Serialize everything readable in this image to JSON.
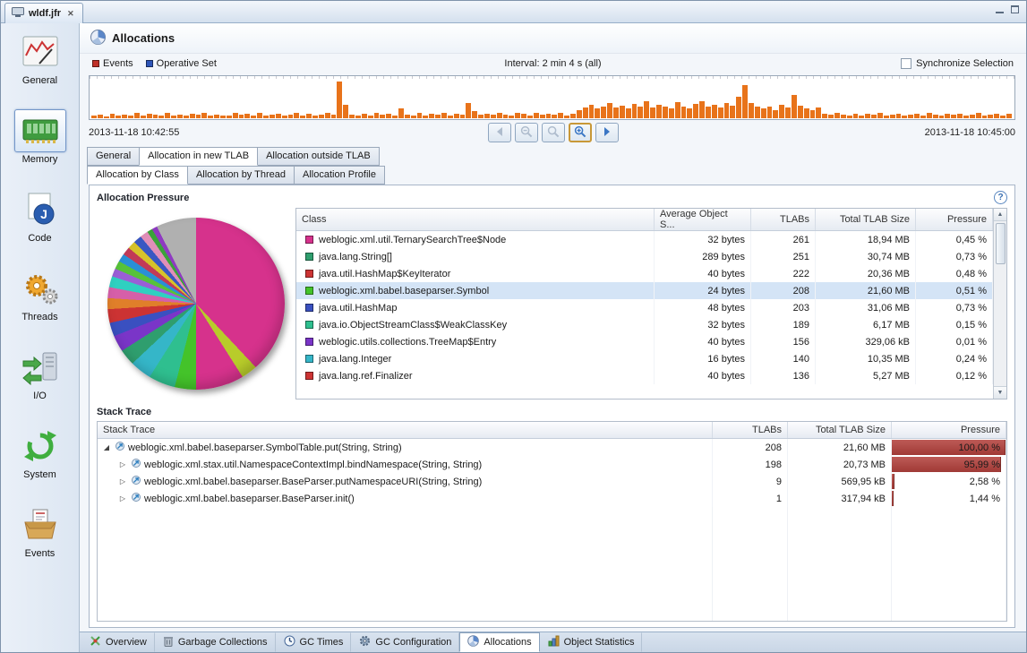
{
  "window": {
    "tab_title": "wldf.jfr"
  },
  "icons": {
    "close": "✕",
    "help": "?",
    "scroll_up": "▲",
    "scroll_down": "▼",
    "expanded": "◢",
    "collapsed": "▷"
  },
  "sidebar": {
    "items": [
      {
        "label": "General",
        "icon": "gauge-icon",
        "selected": false
      },
      {
        "label": "Memory",
        "icon": "ram-icon",
        "selected": true
      },
      {
        "label": "Code",
        "icon": "java-icon",
        "selected": false
      },
      {
        "label": "Threads",
        "icon": "gears-icon",
        "selected": false
      },
      {
        "label": "I/O",
        "icon": "io-arrows-icon",
        "selected": false
      },
      {
        "label": "System",
        "icon": "recycle-icon",
        "selected": false
      },
      {
        "label": "Events",
        "icon": "package-icon",
        "selected": false
      }
    ]
  },
  "header": {
    "title": "Allocations"
  },
  "timeline": {
    "legend": [
      {
        "label": "Events",
        "color": "#c03028"
      },
      {
        "label": "Operative Set",
        "color": "#2e55b8"
      }
    ],
    "interval": "Interval: 2 min 4 s (all)",
    "synchronize_label": "Synchronize Selection",
    "synchronized": false,
    "start": "2013-11-18 10:42:55",
    "end": "2013-11-18 10:45:00",
    "bar_color": "#e8731a",
    "bars": [
      6,
      9,
      5,
      12,
      7,
      10,
      8,
      14,
      6,
      11,
      9,
      7,
      13,
      8,
      10,
      6,
      12,
      9,
      15,
      7,
      10,
      8,
      6,
      13,
      9,
      11,
      7,
      14,
      8,
      10,
      12,
      6,
      9,
      15,
      8,
      11,
      7,
      10,
      13,
      9,
      95,
      35,
      10,
      8,
      12,
      7,
      14,
      9,
      11,
      6,
      25,
      10,
      8,
      13,
      7,
      11,
      9,
      15,
      8,
      12,
      10,
      40,
      18,
      10,
      12,
      9,
      14,
      10,
      8,
      13,
      11,
      7,
      15,
      9,
      12,
      10,
      14,
      8,
      11,
      22,
      28,
      35,
      25,
      30,
      40,
      28,
      33,
      26,
      38,
      30,
      45,
      28,
      35,
      30,
      26,
      42,
      30,
      26,
      38,
      45,
      30,
      35,
      28,
      40,
      32,
      55,
      85,
      40,
      30,
      25,
      30,
      22,
      35,
      28,
      60,
      32,
      25,
      20,
      28,
      12,
      9,
      14,
      10,
      8,
      12,
      7,
      11,
      9,
      13,
      8,
      10,
      12,
      7,
      9,
      11,
      8,
      13,
      10,
      7,
      12,
      9,
      11,
      8,
      10,
      13,
      7,
      9,
      12,
      8,
      11
    ]
  },
  "toolbar": {
    "buttons": [
      {
        "name": "back-button",
        "icon": "arrow-left-icon",
        "enabled": false,
        "focused": false
      },
      {
        "name": "zoom-out-button",
        "icon": "magnifier-minus-icon",
        "enabled": false,
        "focused": false
      },
      {
        "name": "zoom-range-button",
        "icon": "magnifier-icon",
        "enabled": false,
        "focused": false
      },
      {
        "name": "zoom-in-button",
        "icon": "magnifier-plus-icon",
        "enabled": true,
        "focused": true
      },
      {
        "name": "forward-button",
        "icon": "arrow-right-icon",
        "enabled": true,
        "focused": false
      }
    ]
  },
  "tabs": {
    "row1": [
      {
        "label": "General",
        "active": false
      },
      {
        "label": "Allocation in new TLAB",
        "active": true
      },
      {
        "label": "Allocation outside TLAB",
        "active": false
      }
    ],
    "row2": [
      {
        "label": "Allocation by Class",
        "active": true
      },
      {
        "label": "Allocation by Thread",
        "active": false
      },
      {
        "label": "Allocation Profile",
        "active": false
      }
    ]
  },
  "allocation_pressure": {
    "title": "Allocation Pressure",
    "columns": [
      "Class",
      "Average Object S...",
      "TLABs",
      "Total TLAB Size",
      "Pressure"
    ],
    "rows": [
      {
        "color": "#d6328c",
        "class": "weblogic.xml.util.TernarySearchTree$Node",
        "avg": "32 bytes",
        "tlabs": "261",
        "size": "18,94 MB",
        "pressure": "0,45 %",
        "selected": false
      },
      {
        "color": "#2f9e6e",
        "class": "java.lang.String[]",
        "avg": "289 bytes",
        "tlabs": "251",
        "size": "30,74 MB",
        "pressure": "0,73 %",
        "selected": false
      },
      {
        "color": "#cc3333",
        "class": "java.util.HashMap$KeyIterator",
        "avg": "40 bytes",
        "tlabs": "222",
        "size": "20,36 MB",
        "pressure": "0,48 %",
        "selected": false
      },
      {
        "color": "#44c32a",
        "class": "weblogic.xml.babel.baseparser.Symbol",
        "avg": "24 bytes",
        "tlabs": "208",
        "size": "21,60 MB",
        "pressure": "0,51 %",
        "selected": true
      },
      {
        "color": "#3a50c0",
        "class": "java.util.HashMap",
        "avg": "48 bytes",
        "tlabs": "203",
        "size": "31,06 MB",
        "pressure": "0,73 %",
        "selected": false
      },
      {
        "color": "#2fbf8f",
        "class": "java.io.ObjectStreamClass$WeakClassKey",
        "avg": "32 bytes",
        "tlabs": "189",
        "size": "6,17 MB",
        "pressure": "0,15 %",
        "selected": false
      },
      {
        "color": "#7a35c8",
        "class": "weblogic.utils.collections.TreeMap$Entry",
        "avg": "40 bytes",
        "tlabs": "156",
        "size": "329,06 kB",
        "pressure": "0,01 %",
        "selected": false
      },
      {
        "color": "#35b6c8",
        "class": "java.lang.Integer",
        "avg": "16 bytes",
        "tlabs": "140",
        "size": "10,35 MB",
        "pressure": "0,24 %",
        "selected": false
      },
      {
        "color": "#cc3333",
        "class": "java.lang.ref.Finalizer",
        "avg": "40 bytes",
        "tlabs": "136",
        "size": "5,27 MB",
        "pressure": "0,12 %",
        "selected": false
      }
    ]
  },
  "pie": {
    "slices": [
      {
        "color": "#d6328c",
        "pct": 38
      },
      {
        "color": "#b8cc2a",
        "pct": 3
      },
      {
        "color": "#d6328c",
        "pct": 9
      },
      {
        "color": "#44c32a",
        "pct": 4
      },
      {
        "color": "#2fbf8f",
        "pct": 5
      },
      {
        "color": "#35b6c8",
        "pct": 4
      },
      {
        "color": "#2f9e6e",
        "pct": 3
      },
      {
        "color": "#7a35c8",
        "pct": 3
      },
      {
        "color": "#3a50c0",
        "pct": 2.5
      },
      {
        "color": "#cc3333",
        "pct": 2.5
      },
      {
        "color": "#e07f2a",
        "pct": 2
      },
      {
        "color": "#d65fa8",
        "pct": 2
      },
      {
        "color": "#2fd0c0",
        "pct": 2
      },
      {
        "color": "#9a5fd6",
        "pct": 1.5
      },
      {
        "color": "#57c23a",
        "pct": 1.5
      },
      {
        "color": "#2a8fd6",
        "pct": 1.5
      },
      {
        "color": "#c23a57",
        "pct": 1.5
      },
      {
        "color": "#d6c22a",
        "pct": 1.5
      },
      {
        "color": "#3a57c2",
        "pct": 1.5
      },
      {
        "color": "#e08fb8",
        "pct": 1.5
      },
      {
        "color": "#3aa33a",
        "pct": 1
      },
      {
        "color": "#8f3ac2",
        "pct": 1
      },
      {
        "color": "#b0b0b0",
        "pct": 7.5
      }
    ]
  },
  "stack_trace": {
    "title": "Stack Trace",
    "columns": [
      "Stack Trace",
      "TLABs",
      "Total TLAB Size",
      "Pressure"
    ],
    "rows": [
      {
        "method": "weblogic.xml.babel.baseparser.SymbolTable.put(String, String)",
        "tlabs": "208",
        "size": "21,60 MB",
        "pressure": "100,00 %",
        "bar": 100,
        "expanded": true,
        "indent": 0
      },
      {
        "method": "weblogic.xml.stax.util.NamespaceContextImpl.bindNamespace(String, String)",
        "tlabs": "198",
        "size": "20,73 MB",
        "pressure": "95,99 %",
        "bar": 96,
        "expanded": false,
        "indent": 1
      },
      {
        "method": "weblogic.xml.babel.baseparser.BaseParser.putNamespaceURI(String, String)",
        "tlabs": "9",
        "size": "569,95 kB",
        "pressure": "2,58 %",
        "bar": 2.6,
        "expanded": false,
        "indent": 1
      },
      {
        "method": "weblogic.xml.babel.baseparser.BaseParser.init()",
        "tlabs": "1",
        "size": "317,94 kB",
        "pressure": "1,44 %",
        "bar": 1.4,
        "expanded": false,
        "indent": 1
      }
    ]
  },
  "bottom_tabs": [
    {
      "label": "Overview",
      "icon": "overview-icon",
      "active": false
    },
    {
      "label": "Garbage Collections",
      "icon": "trash-icon",
      "active": false
    },
    {
      "label": "GC Times",
      "icon": "clock-icon",
      "active": false
    },
    {
      "label": "GC Configuration",
      "icon": "gear-icon",
      "active": false
    },
    {
      "label": "Allocations",
      "icon": "pie-icon",
      "active": true
    },
    {
      "label": "Object Statistics",
      "icon": "stats-icon",
      "active": false
    }
  ]
}
